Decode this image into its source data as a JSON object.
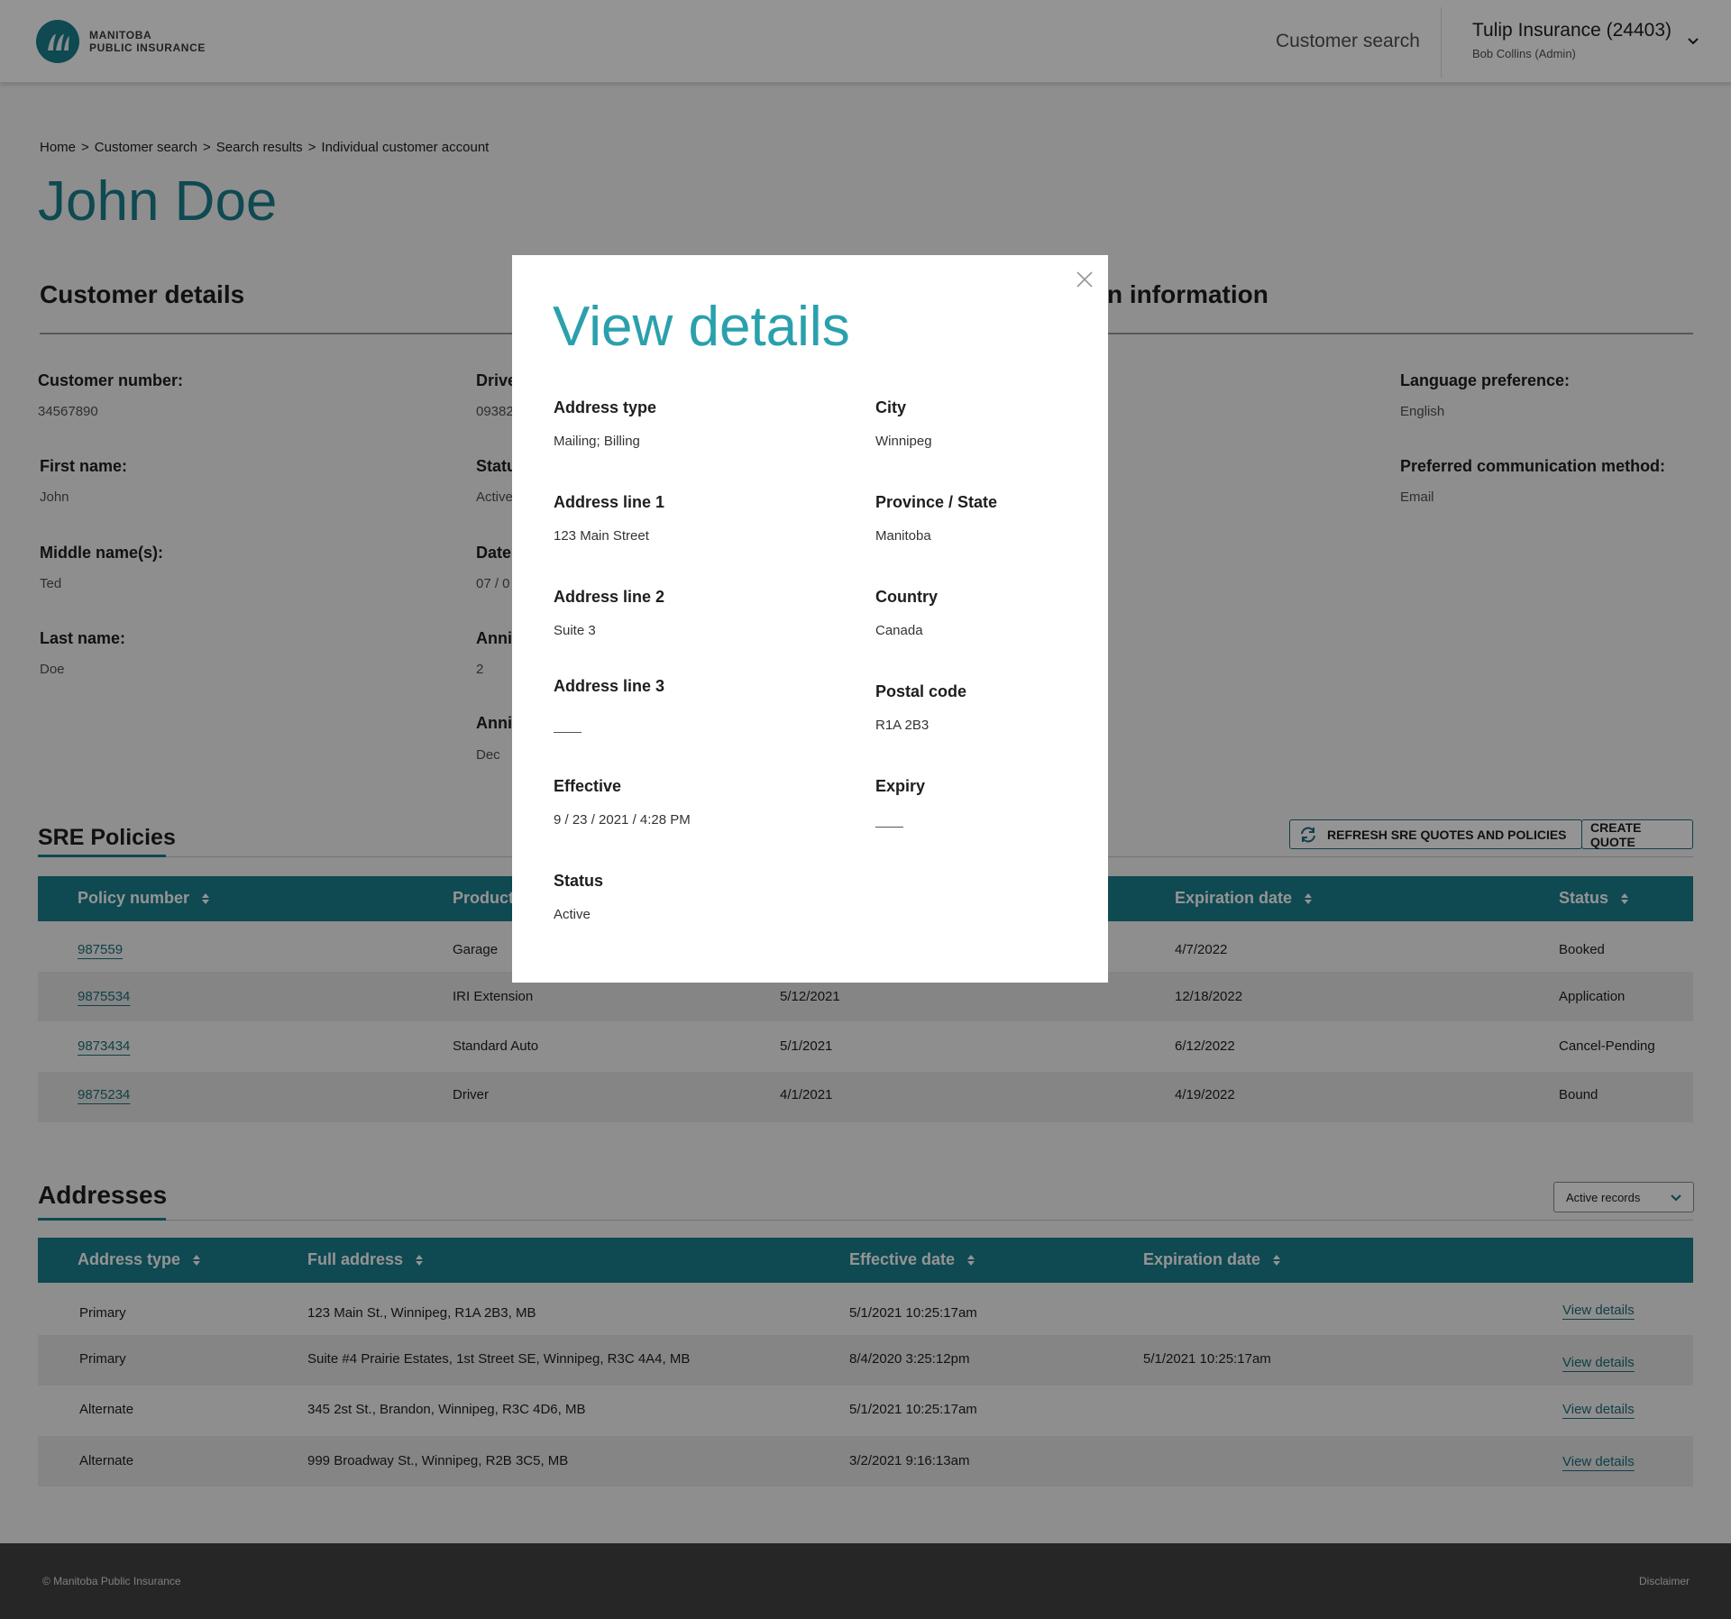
{
  "header": {
    "logo_line1": "MANITOBA",
    "logo_line2": "PUBLIC INSURANCE",
    "nav_customer_search": "Customer search",
    "org_name": "Tulip Insurance (24403)",
    "org_user": "Bob Collins (Admin)"
  },
  "breadcrumb": [
    "Home",
    ">",
    "Customer search",
    ">",
    "Search results",
    ">",
    "Individual customer account"
  ],
  "page_title": "John Doe",
  "customer_details": {
    "title": "Customer details",
    "customer_number_label": "Customer number:",
    "customer_number": "34567890",
    "first_name_label": "First name:",
    "first_name": "John",
    "middle_name_label": "Middle name(s):",
    "middle_name": "Ted",
    "last_name_label": "Last name:",
    "last_name": "Doe",
    "col2_labels": [
      "Drive",
      "Statu",
      "Date",
      "Anniv",
      "Anniv"
    ],
    "col2_values": [
      "09382",
      "Active",
      "07 / 0",
      "2",
      "Dec"
    ]
  },
  "communication": {
    "title_fragment": "n information",
    "language_label": "Language preference:",
    "language": "English",
    "method_label": "Preferred communication method:",
    "method": "Email"
  },
  "sre_policies": {
    "title": "SRE Policies",
    "refresh_button": "REFRESH SRE QUOTES AND POLICIES",
    "create_button": "CREATE QUOTE",
    "columns": [
      "Policy number",
      "Product",
      "Expiration date",
      "Status"
    ],
    "rows": [
      {
        "policy": "987559",
        "product": "Garage",
        "effective": "",
        "expiration": "4/7/2022",
        "status": "Booked"
      },
      {
        "policy": "9875534",
        "product": "IRI Extension",
        "effective": "5/12/2021",
        "expiration": "12/18/2022",
        "status": "Application"
      },
      {
        "policy": "9873434",
        "product": "Standard Auto",
        "effective": "5/1/2021",
        "expiration": "6/12/2022",
        "status": "Cancel-Pending"
      },
      {
        "policy": "9875234",
        "product": "Driver",
        "effective": "4/1/2021",
        "expiration": "4/19/2022",
        "status": "Bound"
      }
    ]
  },
  "addresses": {
    "title": "Addresses",
    "filter_value": "Active records",
    "columns": [
      "Address type",
      "Full address",
      "Effective date",
      "Expiration date"
    ],
    "view_details_label": "View details",
    "rows": [
      {
        "type": "Primary",
        "address": "123 Main St., Winnipeg, R1A 2B3, MB",
        "effective": "5/1/2021 10:25:17am",
        "expiration": ""
      },
      {
        "type": "Primary",
        "address": "Suite #4 Prairie Estates, 1st Street SE, Winnipeg, R3C 4A4, MB",
        "effective": "8/4/2020 3:25:12pm",
        "expiration": "5/1/2021 10:25:17am"
      },
      {
        "type": "Alternate",
        "address": "345 2st St., Brandon, Winnipeg, R3C 4D6, MB",
        "effective": "5/1/2021 10:25:17am",
        "expiration": ""
      },
      {
        "type": "Alternate",
        "address": "999 Broadway St., Winnipeg, R2B 3C5, MB",
        "effective": "3/2/2021 9:16:13am",
        "expiration": ""
      }
    ]
  },
  "footer": {
    "copyright": "© Manitoba Public Insurance",
    "disclaimer": "Disclaimer"
  },
  "modal": {
    "title": "View details",
    "address_type_label": "Address type",
    "address_type": "Mailing; Billing",
    "city_label": "City",
    "city": "Winnipeg",
    "address_line1_label": "Address line 1",
    "address_line1": "123 Main Street",
    "province_label": "Province / State",
    "province": "Manitoba",
    "address_line2_label": "Address line 2",
    "address_line2": "Suite 3",
    "country_label": "Country",
    "country": "Canada",
    "address_line3_label": "Address line 3",
    "postal_code_label": "Postal code",
    "postal_code": "R1A 2B3",
    "effective_label": "Effective",
    "effective": "9 / 23 / 2021 / 4:28 PM",
    "expiry_label": "Expiry",
    "status_label": "Status",
    "status": "Active"
  },
  "colors": {
    "brand_teal": "#1b7f8e",
    "modal_title": "#2aa0ad",
    "footer_bg": "#424242"
  }
}
